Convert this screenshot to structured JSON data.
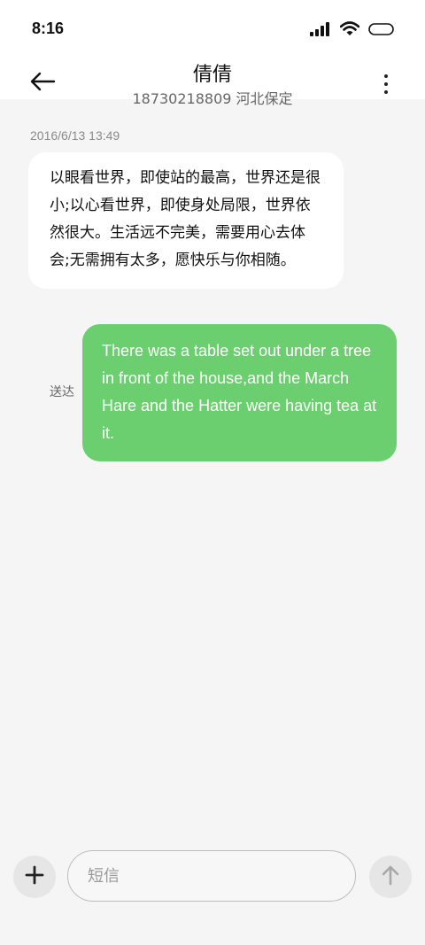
{
  "status_bar": {
    "time": "8:16",
    "icons": [
      "signal-icon",
      "wifi-icon",
      "battery-icon"
    ]
  },
  "header": {
    "contact_name": "倩倩",
    "subtitle": "18730218809 河北保定",
    "back_icon": "back-arrow-icon",
    "more_icon": "more-vertical-icon"
  },
  "conversation": {
    "timestamp": "2016/6/13 13:49",
    "incoming_message": "以眼看世界，即使站的最高，世界还是很小;以心看世界，即使身处局限，世界依然很大。生活远不完美，需要用心去体会;无需拥有太多，愿快乐与你相随。",
    "outgoing_message": "There was a table set out under a tree in front of the house,and the March Hare and the Hatter were having tea at it.",
    "delivery_status": "送达"
  },
  "composer": {
    "placeholder": "短信",
    "value": "",
    "add_icon": "plus-icon",
    "send_icon": "arrow-up-icon"
  },
  "colors": {
    "outgoing_bubble": "#6ccf6f",
    "incoming_bubble": "#ffffff",
    "background": "#f5f5f5"
  }
}
